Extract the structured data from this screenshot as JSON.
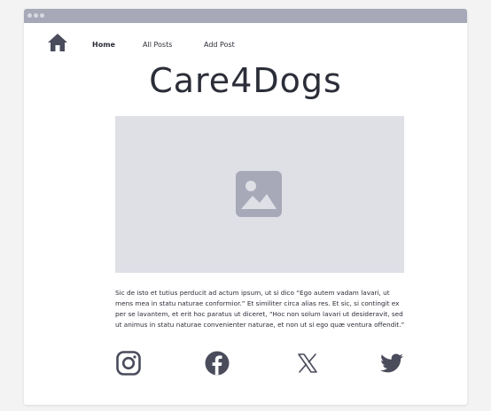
{
  "window": {
    "controls": [
      "close",
      "minimize",
      "maximize"
    ]
  },
  "nav": {
    "home_icon": "house-icon",
    "links": [
      {
        "label": "Home",
        "active": true
      },
      {
        "label": "All Posts",
        "active": false
      },
      {
        "label": "Add Post",
        "active": false
      }
    ]
  },
  "site": {
    "title": "Care4Dogs"
  },
  "hero": {
    "icon": "image-placeholder-icon"
  },
  "article": {
    "text": "Sic de isto et tutius perducit ad actum ipsum, ut si dico “Ego autem vadam lavari, ut mens mea in statu naturae conformior.” Et similiter circa alias res. Et sic, si contingit ex per se lavantem, et erit hoc paratus ut diceret, “Hoc non solum lavari ut desideravit, sed ut animus in statu naturae convenienter naturae, et non ut si ego quæ ventura offendit.”"
  },
  "social": [
    {
      "name": "Instagram",
      "icon": "instagram-icon"
    },
    {
      "name": "Facebook",
      "icon": "facebook-icon"
    },
    {
      "name": "X",
      "icon": "x-icon"
    },
    {
      "name": "Twitter",
      "icon": "twitter-icon"
    }
  ],
  "colors": {
    "titlebar": "#a7a9b8",
    "text": "#2b2d38",
    "icon": "#4a4c5c",
    "placeholder_bg": "#dfdfe6",
    "placeholder_icon": "#a7a9b8"
  }
}
